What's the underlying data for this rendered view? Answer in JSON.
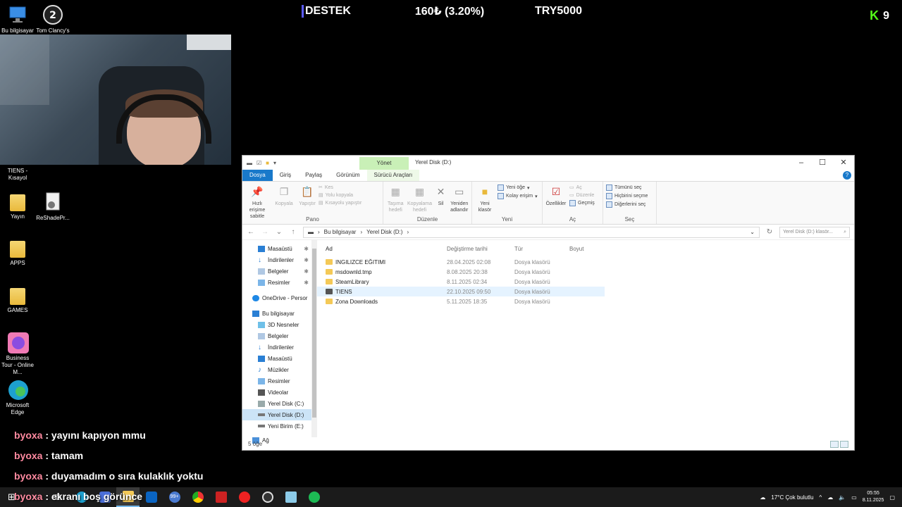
{
  "overlay": {
    "banner_left": "DESTEK",
    "banner_mid": "160₺ (3.20%)",
    "banner_right": "TRY5000",
    "kick_letter": "K",
    "kick_count": "9"
  },
  "desktop_icons": [
    {
      "label": "Bu bilgisayar"
    },
    {
      "label": "Tom Clancy's"
    },
    {
      "label": "TIENS - Kısayol"
    },
    {
      "label": "Yayın"
    },
    {
      "label": "ReShadePr..."
    },
    {
      "label": "APPS"
    },
    {
      "label": "GAMES"
    },
    {
      "label": "Business Tour - Online M..."
    },
    {
      "label": "Microsoft Edge"
    }
  ],
  "explorer": {
    "title": "Yerel Disk (D:)",
    "context_tab_group": "Yönet",
    "tabs": [
      "Dosya",
      "Giriş",
      "Paylaş",
      "Görünüm",
      "Sürücü Araçları"
    ],
    "ribbon": {
      "pano": {
        "name": "Pano",
        "pin": "Hızlı erişime sabitle",
        "copy": "Kopyala",
        "paste": "Yapıştır",
        "cut": "Kes",
        "copy_path": "Yolu kopyala",
        "paste_shortcut": "Kısayolu yapıştır"
      },
      "duzenle": {
        "name": "Düzenle",
        "move": "Taşıma hedefi",
        "copyto": "Kopyalama hedefi",
        "delete": "Sil",
        "rename": "Yeniden adlandır"
      },
      "yeni": {
        "name": "Yeni",
        "new_folder": "Yeni klasör",
        "new_item": "Yeni öğe",
        "easy_access": "Kolay erişim"
      },
      "ac": {
        "name": "Aç",
        "properties": "Özellikler",
        "open": "Aç",
        "edit": "Düzenle",
        "history": "Geçmiş"
      },
      "sec": {
        "name": "Seç",
        "select_all": "Tümünü seç",
        "select_none": "Hiçbirini seçme",
        "invert": "Diğerlerini seç"
      }
    },
    "breadcrumb": [
      "Bu bilgisayar",
      "Yerel Disk (D:)"
    ],
    "search_placeholder": "Yerel Disk (D:) klasör...",
    "nav": [
      {
        "label": "Masaüstü",
        "pinned": true
      },
      {
        "label": "İndirilenler",
        "pinned": true
      },
      {
        "label": "Belgeler",
        "pinned": true
      },
      {
        "label": "Resimler",
        "pinned": true
      },
      {
        "label": "OneDrive - Persor"
      },
      {
        "label": "Bu bilgisayar"
      },
      {
        "label": "3D Nesneler"
      },
      {
        "label": "Belgeler"
      },
      {
        "label": "İndirilenler"
      },
      {
        "label": "Masaüstü"
      },
      {
        "label": "Müzikler"
      },
      {
        "label": "Resimler"
      },
      {
        "label": "Videolar"
      },
      {
        "label": "Yerel Disk (C:)"
      },
      {
        "label": "Yerel Disk (D:)"
      },
      {
        "label": "Yeni Birim (E:)"
      },
      {
        "label": "Ağ"
      }
    ],
    "columns": [
      "Ad",
      "Değiştirme tarihi",
      "Tür",
      "Boyut"
    ],
    "files": [
      {
        "name": "INGILIZCE EĞITIMI",
        "date": "28.04.2025 02:08",
        "type": "Dosya klasörü",
        "size": ""
      },
      {
        "name": "msdownld.tmp",
        "date": "8.08.2025 20:38",
        "type": "Dosya klasörü",
        "size": ""
      },
      {
        "name": "SteamLibrary",
        "date": "8.11.2025 02:34",
        "type": "Dosya klasörü",
        "size": ""
      },
      {
        "name": "TIENS",
        "date": "22.10.2025 09:50",
        "type": "Dosya klasörü",
        "size": ""
      },
      {
        "name": "Zona Downloads",
        "date": "5.11.2025 18:35",
        "type": "Dosya klasörü",
        "size": ""
      }
    ],
    "status": "5 öğe"
  },
  "chat": [
    {
      "user": "byoxa",
      "sep": " : ",
      "msg": "yayını kapıyon mmu"
    },
    {
      "user": "byoxa",
      "sep": " : ",
      "msg": "tamam"
    },
    {
      "user": "byoxa",
      "sep": " : ",
      "msg": "duyamadım o sıra kulaklık yoktu"
    },
    {
      "user": "byoxa",
      "sep": " : ",
      "msg": "ekranı boş görünce"
    }
  ],
  "taskbar": {
    "weather": "17°C  Çok bulutlu",
    "time": "05:55",
    "date": "8.11.2025",
    "badge": "99+"
  }
}
